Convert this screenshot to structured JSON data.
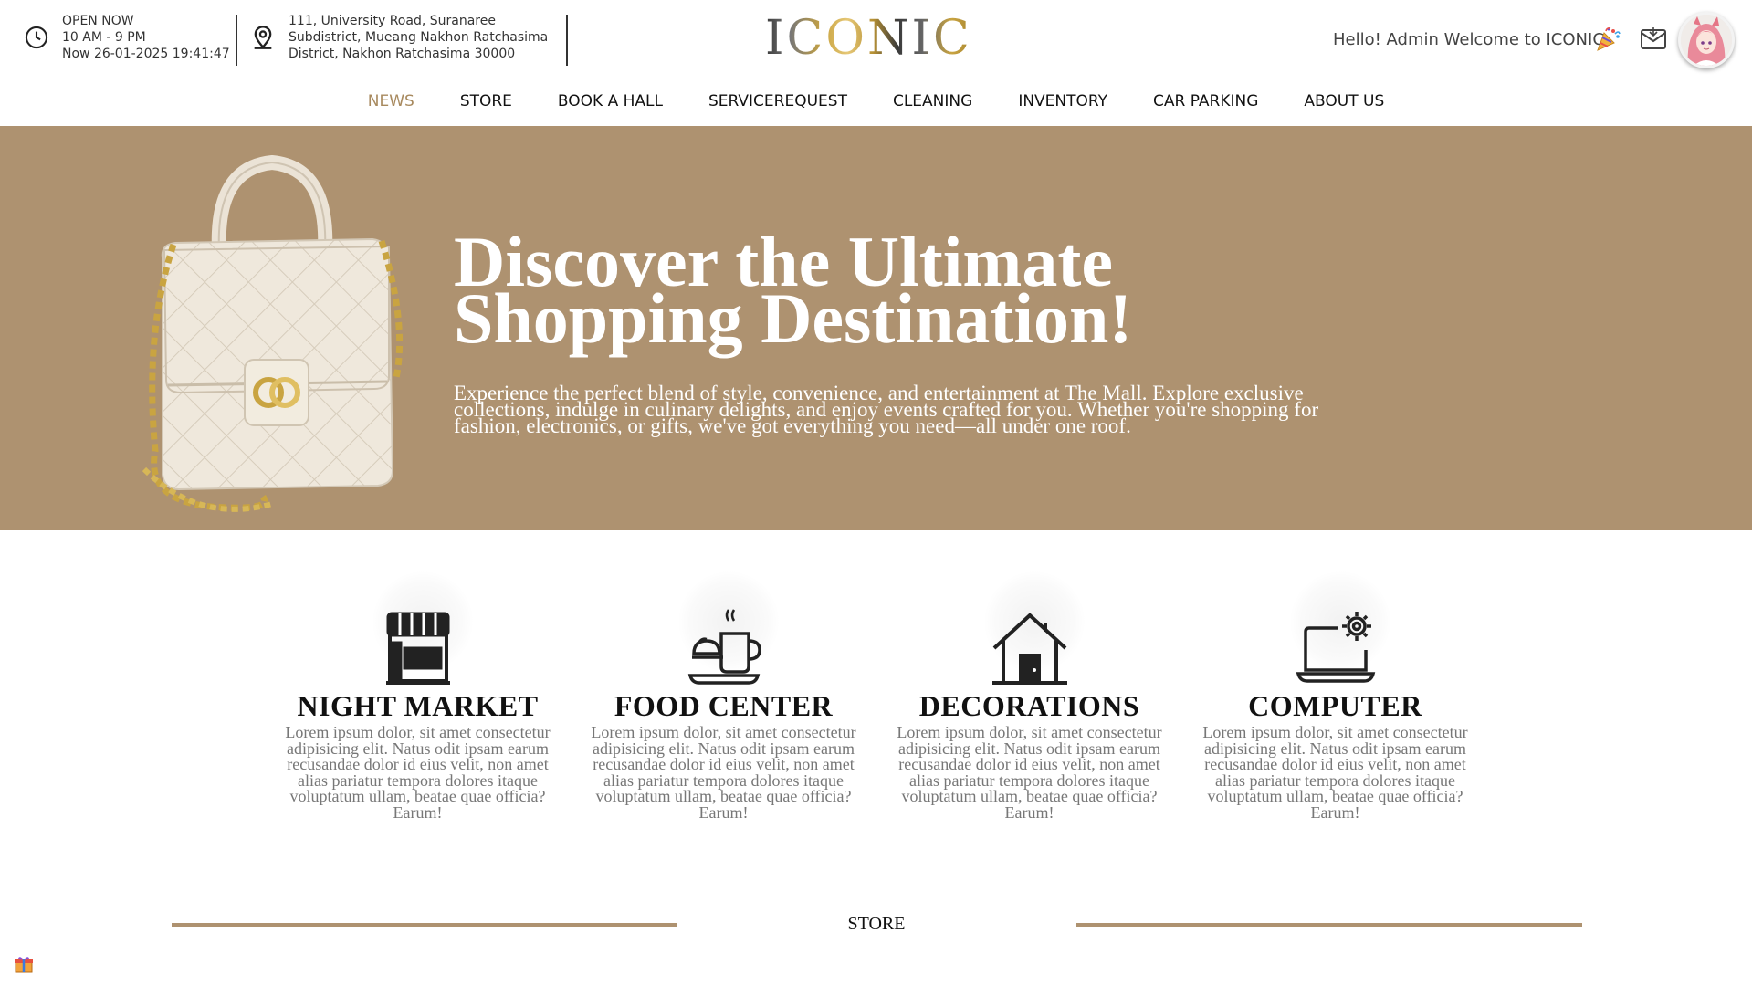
{
  "header": {
    "open_status": "OPEN NOW",
    "hours": "10 AM - 9 PM",
    "now": "Now 26-01-2025 19:41:47",
    "address_line1": "111, University Road, Suranaree",
    "address_line2": "Subdistrict, Mueang Nakhon Ratchasima",
    "address_line3": "District, Nakhon Ratchasima 30000",
    "logo": "ICONIC",
    "greeting": "Hello! Admin Welcome to ICONIC"
  },
  "nav": {
    "items": [
      {
        "label": "NEWS"
      },
      {
        "label": "STORE"
      },
      {
        "label": "BOOK A HALL"
      },
      {
        "label": "SERVICEREQUEST"
      },
      {
        "label": "CLEANING"
      },
      {
        "label": "INVENTORY"
      },
      {
        "label": "CAR PARKING"
      },
      {
        "label": "ABOUT US"
      }
    ],
    "active": "NEWS"
  },
  "hero": {
    "title_line1": "Discover the Ultimate",
    "title_line2": "Shopping Destination!",
    "subtitle": "Experience the perfect blend of style, convenience, and entertainment at The Mall. Explore exclusive collections, indulge in culinary delights, and enjoy events crafted for you. Whether you're shopping for fashion, electronics, or gifts, we've got everything you need—all under one roof.",
    "background_color": "#ae9270"
  },
  "features": [
    {
      "title": "NIGHT MARKET",
      "icon": "market-stall-icon",
      "text": "Lorem ipsum dolor, sit amet consectetur adipisicing elit. Natus odit ipsam earum recusandae dolor id eius velit, non amet alias pariatur tempora dolores itaque voluptatum ullam, beatae quae officia? Earum!"
    },
    {
      "title": "FOOD CENTER",
      "icon": "coffee-cup-icon",
      "text": "Lorem ipsum dolor, sit amet consectetur adipisicing elit. Natus odit ipsam earum recusandae dolor id eius velit, non amet alias pariatur tempora dolores itaque voluptatum ullam, beatae quae officia? Earum!"
    },
    {
      "title": "DECORATIONS",
      "icon": "house-icon",
      "text": "Lorem ipsum dolor, sit amet consectetur adipisicing elit. Natus odit ipsam earum recusandae dolor id eius velit, non amet alias pariatur tempora dolores itaque voluptatum ullam, beatae quae officia? Earum!"
    },
    {
      "title": "COMPUTER",
      "icon": "laptop-gear-icon",
      "text": "Lorem ipsum dolor, sit amet consectetur adipisicing elit. Natus odit ipsam earum recusandae dolor id eius velit, non amet alias pariatur tempora dolores itaque voluptatum ullam, beatae quae officia? Earum!"
    }
  ],
  "store_section": {
    "label": "STORE",
    "accent": "#ae9270"
  },
  "colors": {
    "accent": "#ae9270",
    "active_nav": "#a88a5f"
  }
}
